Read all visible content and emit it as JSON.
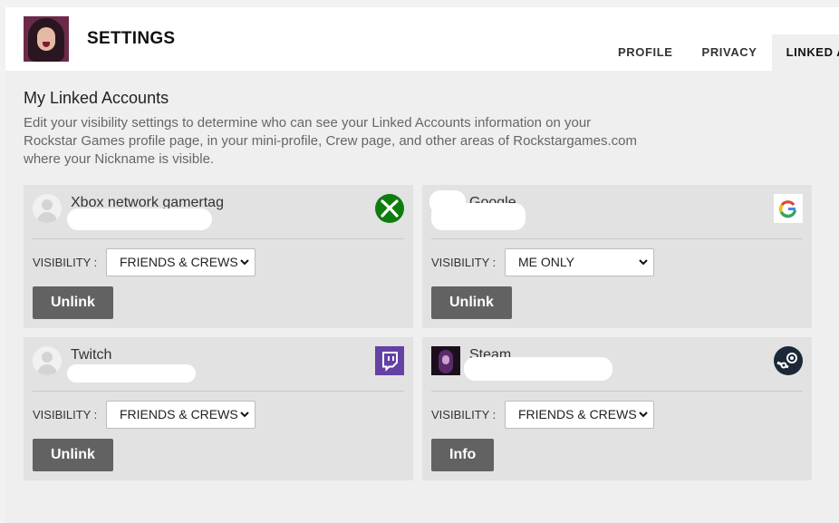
{
  "header": {
    "title": "SETTINGS",
    "tabs": [
      {
        "label": "PROFILE",
        "active": false
      },
      {
        "label": "PRIVACY",
        "active": false
      },
      {
        "label": "LINKED A",
        "active": true
      }
    ]
  },
  "section": {
    "title": "My Linked Accounts",
    "description": "Edit your visibility settings to determine who can see your Linked Accounts information on your Rockstar Games profile page, in your mini-profile, Crew page, and other areas of Rockstargames.com where your Nickname is visible."
  },
  "visibility_label": "VISIBILITY :",
  "accounts": [
    {
      "name": "Xbox network gamertag",
      "platform_icon": "xbox-icon",
      "visibility": "FRIENDS & CREWS",
      "button": "Unlink"
    },
    {
      "name": "Google",
      "platform_icon": "google-icon",
      "visibility": "ME ONLY",
      "button": "Unlink"
    },
    {
      "name": "Twitch",
      "platform_icon": "twitch-icon",
      "visibility": "FRIENDS & CREWS",
      "button": "Unlink"
    },
    {
      "name": "Steam",
      "platform_icon": "steam-icon",
      "visibility": "FRIENDS & CREWS",
      "button": "Info"
    }
  ],
  "colors": {
    "xbox": "#107c10",
    "twitch": "#6441a5",
    "steam": "#1b2838",
    "button": "#626262",
    "card": "#e2e2e2"
  }
}
